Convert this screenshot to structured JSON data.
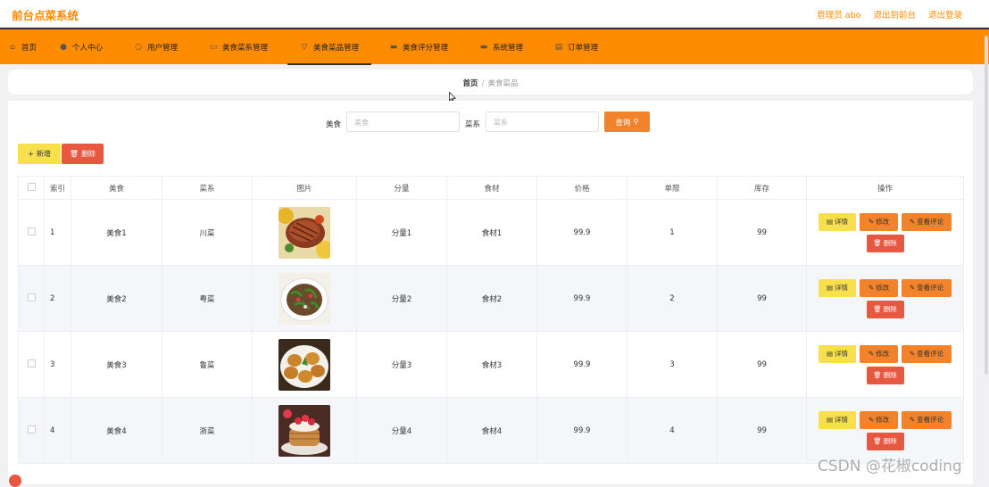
{
  "app": {
    "title": "前台点菜系统"
  },
  "top_links": [
    "管理员 abo",
    "退出到前台",
    "退出登录"
  ],
  "nav": [
    {
      "label": "首页",
      "icon": "home-icon"
    },
    {
      "label": "个人中心",
      "icon": "user-icon"
    },
    {
      "label": "用户管理",
      "icon": "users-icon"
    },
    {
      "label": "美食菜系管理",
      "icon": "folder-icon"
    },
    {
      "label": "美食菜品管理",
      "icon": "filter-icon",
      "active": true
    },
    {
      "label": "美食评分管理",
      "icon": "chart-icon"
    },
    {
      "label": "系统管理",
      "icon": "system-icon"
    },
    {
      "label": "订单管理",
      "icon": "order-icon"
    }
  ],
  "breadcrumb": {
    "home": "首页",
    "separator": "/",
    "current": "美食菜品"
  },
  "search": {
    "food_label": "美食",
    "food_placeholder": "美食",
    "cuisine_label": "菜系",
    "cuisine_placeholder": "菜系",
    "button": "查询"
  },
  "actions": {
    "add": "新增",
    "delete": "删除"
  },
  "table": {
    "headers": [
      "索引",
      "美食",
      "菜系",
      "图片",
      "分量",
      "食材",
      "价格",
      "单限",
      "库存",
      "操作"
    ],
    "rows": [
      {
        "index": "1",
        "food": "美食1",
        "cuisine": "川菜",
        "portion": "分量1",
        "ingredient": "食材1",
        "price": "99.9",
        "limit": "1",
        "stock": "99"
      },
      {
        "index": "2",
        "food": "美食2",
        "cuisine": "粤菜",
        "portion": "分量2",
        "ingredient": "食材2",
        "price": "99.9",
        "limit": "2",
        "stock": "99"
      },
      {
        "index": "3",
        "food": "美食3",
        "cuisine": "鲁菜",
        "portion": "分量3",
        "ingredient": "食材3",
        "price": "99.9",
        "limit": "3",
        "stock": "99"
      },
      {
        "index": "4",
        "food": "美食4",
        "cuisine": "浙菜",
        "portion": "分量4",
        "ingredient": "食材4",
        "price": "99.9",
        "limit": "4",
        "stock": "99"
      }
    ],
    "row_actions": {
      "detail": "详情",
      "edit": "修改",
      "review": "查看评论",
      "delete": "删除"
    }
  },
  "watermark": "CSDN @花椒coding",
  "colors": {
    "accent": "#ff8c00",
    "yellow": "#f7e04b",
    "orange": "#f2832a",
    "red": "#e6583f"
  }
}
